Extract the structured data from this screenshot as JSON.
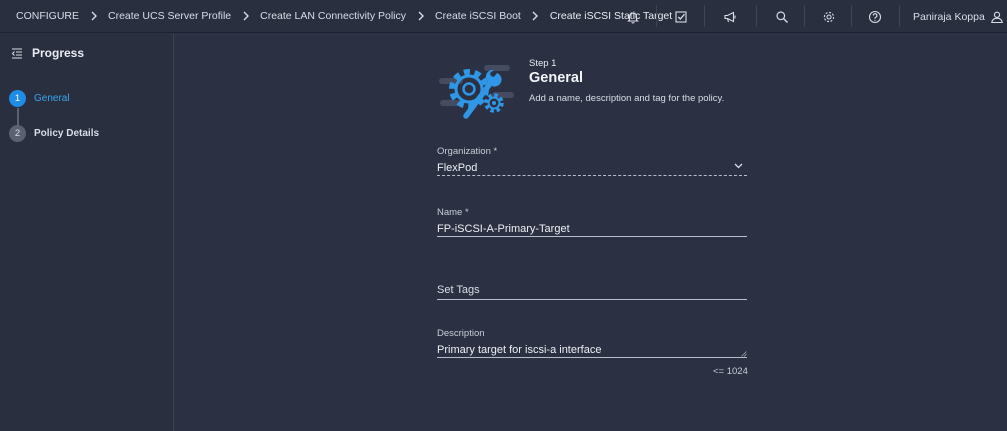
{
  "breadcrumbs": [
    {
      "label": "CONFIGURE"
    },
    {
      "label": "Create UCS Server Profile"
    },
    {
      "label": "Create LAN Connectivity Policy"
    },
    {
      "label": "Create iSCSI Boot"
    },
    {
      "label": "Create iSCSI Static Target"
    }
  ],
  "toolbar": {
    "icons": [
      "bell-icon",
      "task-check-icon",
      "megaphone-icon",
      "search-icon",
      "gear-icon",
      "help-icon"
    ],
    "user_name": "Paniraja Koppa",
    "user_icon": "user-icon"
  },
  "sidebar": {
    "title": "Progress",
    "steps": [
      {
        "number": "1",
        "label": "General",
        "state": "active"
      },
      {
        "number": "2",
        "label": "Policy Details",
        "state": "inactive"
      }
    ]
  },
  "header": {
    "step_label": "Step 1",
    "title": "General",
    "description": "Add a name, description and tag for the policy."
  },
  "form": {
    "organization": {
      "label": "Organization *",
      "value": "FlexPod"
    },
    "name": {
      "label": "Name *",
      "value": "FP-iSCSI-A-Primary-Target"
    },
    "tags": {
      "placeholder": "Set Tags"
    },
    "description": {
      "label": "Description",
      "value": "Primary target for iscsi-a interface",
      "limit": "<= 1024"
    }
  },
  "colors": {
    "background": "#2b3142",
    "sidebar": "#2a2f40",
    "accent": "#1f8ce6",
    "active_text": "#36a6f2"
  }
}
